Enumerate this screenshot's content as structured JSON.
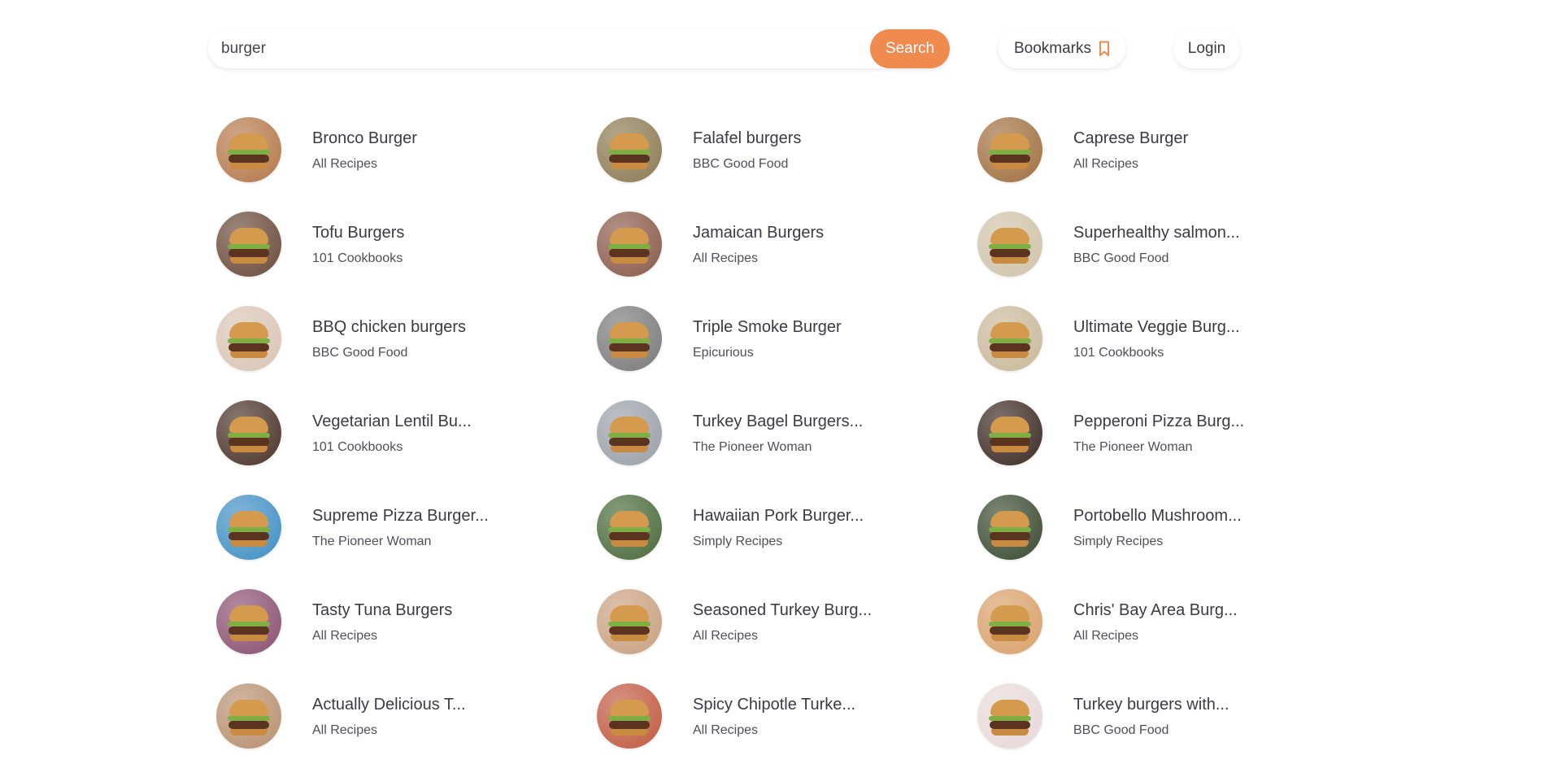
{
  "search": {
    "value": "burger",
    "button_label": "Search"
  },
  "nav": {
    "bookmarks_label": "Bookmarks",
    "login_label": "Login"
  },
  "colors": {
    "accent": "#f08a4f",
    "text": "#3b3a46"
  },
  "recipes": [
    {
      "title": "Bronco Burger",
      "source": "All Recipes"
    },
    {
      "title": "Falafel burgers",
      "source": "BBC Good Food"
    },
    {
      "title": "Caprese Burger",
      "source": "All Recipes"
    },
    {
      "title": "Tofu Burgers",
      "source": "101 Cookbooks"
    },
    {
      "title": "Jamaican Burgers",
      "source": "All Recipes"
    },
    {
      "title": "Superhealthy salmon...",
      "source": "BBC Good Food"
    },
    {
      "title": "BBQ chicken burgers",
      "source": "BBC Good Food"
    },
    {
      "title": "Triple Smoke Burger",
      "source": "Epicurious"
    },
    {
      "title": "Ultimate Veggie Burg...",
      "source": "101 Cookbooks"
    },
    {
      "title": "Vegetarian Lentil Bu...",
      "source": "101 Cookbooks"
    },
    {
      "title": "Turkey Bagel Burgers...",
      "source": "The Pioneer Woman"
    },
    {
      "title": "Pepperoni Pizza Burg...",
      "source": "The Pioneer Woman"
    },
    {
      "title": "Supreme Pizza Burger...",
      "source": "The Pioneer Woman"
    },
    {
      "title": "Hawaiian Pork Burger...",
      "source": "Simply Recipes"
    },
    {
      "title": "Portobello Mushroom...",
      "source": "Simply Recipes"
    },
    {
      "title": "Tasty Tuna Burgers",
      "source": "All Recipes"
    },
    {
      "title": "Seasoned Turkey Burg...",
      "source": "All Recipes"
    },
    {
      "title": "Chris' Bay Area Burg...",
      "source": "All Recipes"
    },
    {
      "title": "Actually Delicious T...",
      "source": "All Recipes"
    },
    {
      "title": "Spicy Chipotle Turke...",
      "source": "All Recipes"
    },
    {
      "title": "Turkey burgers with...",
      "source": "BBC Good Food"
    }
  ]
}
